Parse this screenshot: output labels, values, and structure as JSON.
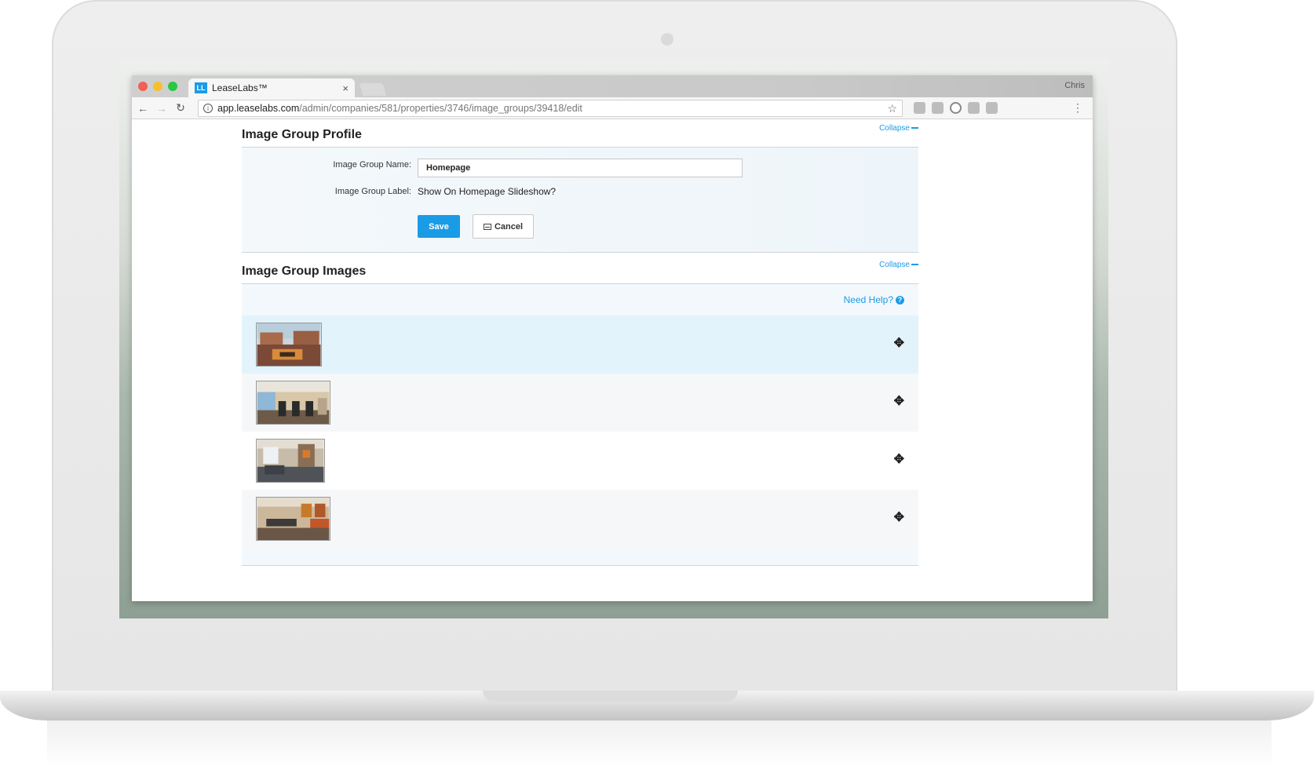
{
  "browser": {
    "tab_title": "LeaseLabs™",
    "tab_favicon": "LL",
    "tab_close": "×",
    "user_name": "Chris",
    "url_host": "app.leaselabs.com",
    "url_path": "/admin/companies/581/properties/3746/image_groups/39418/edit",
    "back_glyph": "←",
    "forward_glyph": "→",
    "reload_glyph": "↻",
    "star_glyph": "☆",
    "menu_glyph": "⋮",
    "info_glyph": "i"
  },
  "profile": {
    "title": "Image Group Profile",
    "collapse_label": "Collapse",
    "name_label": "Image Group Name:",
    "name_value": "Homepage",
    "label_label": "Image Group Label:",
    "label_value": "Show On Homepage Slideshow?",
    "save_label": "Save",
    "cancel_label": "Cancel"
  },
  "images": {
    "title": "Image Group Images",
    "collapse_label": "Collapse",
    "help_label": "Need Help?",
    "help_glyph": "?",
    "move_glyph": "✥",
    "rows": [
      {
        "thumb": "pool-courtyard-photo"
      },
      {
        "thumb": "fitness-center-photo"
      },
      {
        "thumb": "clubhouse-lounge-photo"
      },
      {
        "thumb": "dining-area-photo"
      }
    ]
  },
  "colors": {
    "accent": "#1a9be6",
    "row_highlight": "#e2f3fc"
  }
}
